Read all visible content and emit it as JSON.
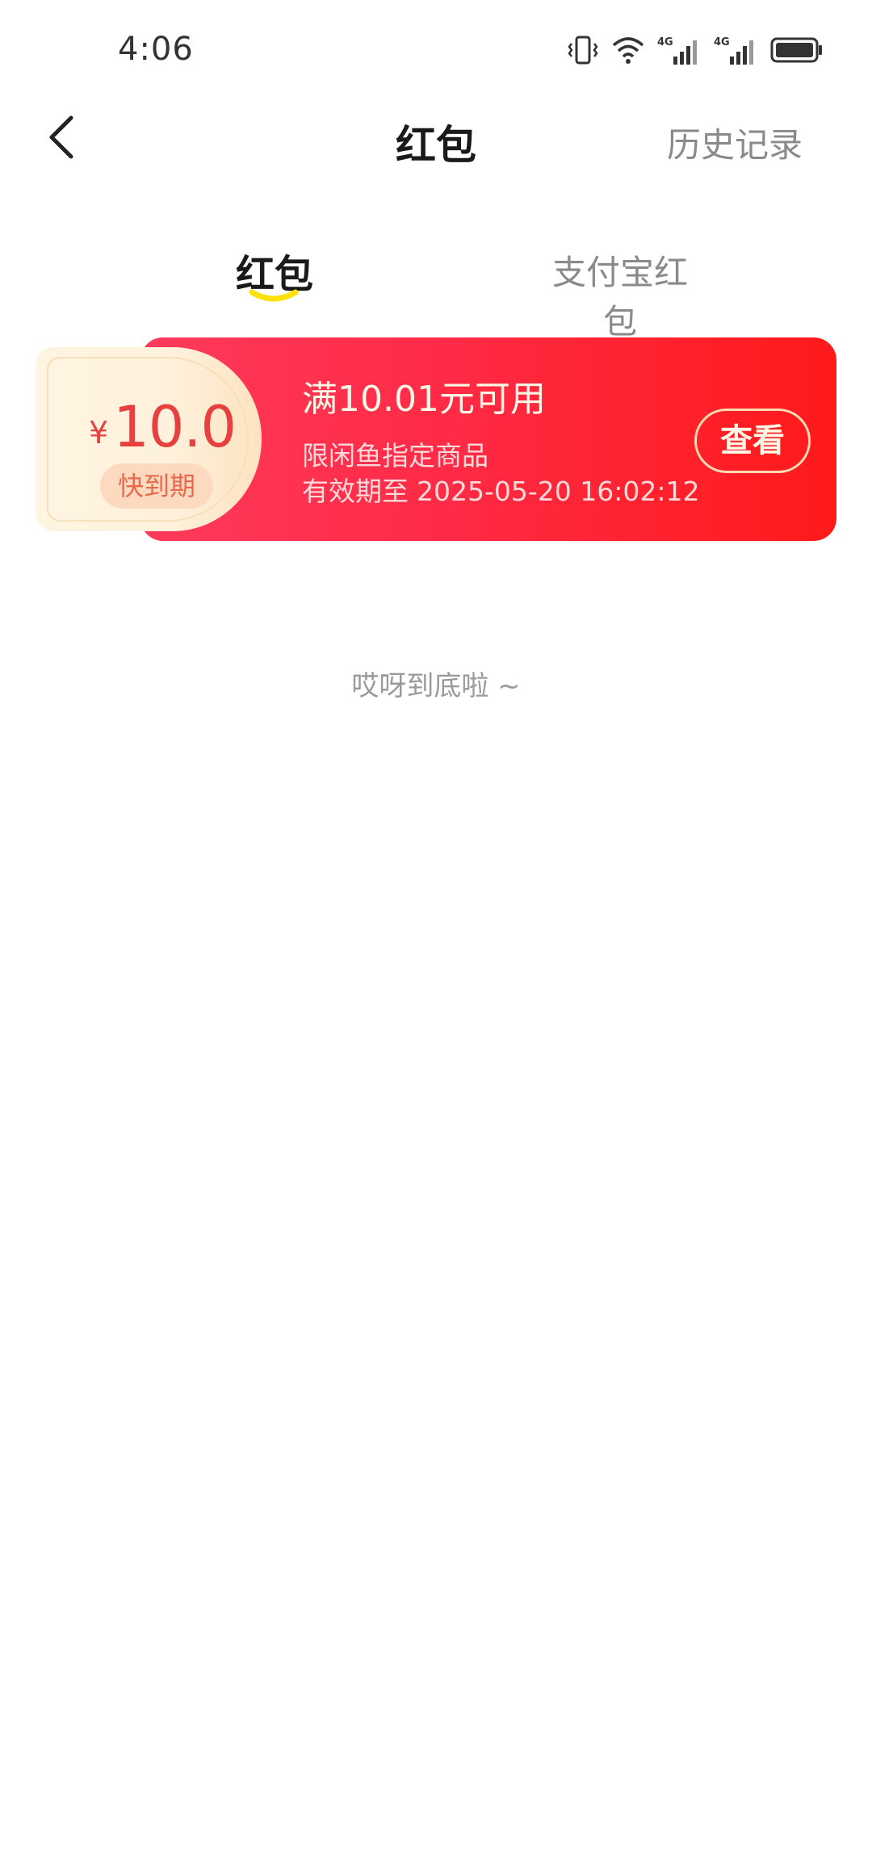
{
  "status_bar": {
    "time": "4:06",
    "icons": [
      "vibrate-icon",
      "wifi-icon",
      "signal-4g-icon",
      "signal-4g-icon",
      "battery-icon"
    ],
    "network_label": "4G"
  },
  "header": {
    "title": "红包",
    "history_label": "历史记录"
  },
  "tabs": [
    {
      "label": "红包",
      "active": true
    },
    {
      "label": "支付宝红包",
      "active": false
    }
  ],
  "coupons": [
    {
      "currency": "¥",
      "amount": "10.0",
      "badge": "快到期",
      "condition": "满10.01元可用",
      "scope": "限闲鱼指定商品",
      "validity_label": "有效期至",
      "validity_date": "2025-05-20 16:02:12",
      "action_label": "查看"
    }
  ],
  "list_end_text": "哎呀到底啦 ~",
  "colors": {
    "accent_yellow": "#ffe10a",
    "coupon_red": "#ff1a1a",
    "amount_red": "#e8403e",
    "muted_text": "#8a8a8a"
  }
}
